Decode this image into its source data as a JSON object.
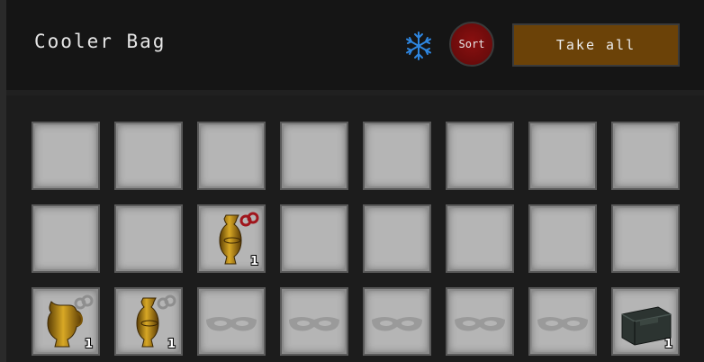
{
  "container": {
    "title": "Cooler Bag",
    "icons": {
      "freeze": "snowflake-icon",
      "freeze_color": "#2e86e0"
    },
    "buttons": {
      "sort_label": "Sort",
      "take_all_label": "Take all"
    }
  },
  "grid": {
    "rows": [
      [
        {
          "state": "empty"
        },
        {
          "state": "empty"
        },
        {
          "state": "empty"
        },
        {
          "state": "empty"
        },
        {
          "state": "empty"
        },
        {
          "state": "empty"
        },
        {
          "state": "empty"
        },
        {
          "state": "empty"
        }
      ],
      [
        {
          "state": "empty"
        },
        {
          "state": "empty"
        },
        {
          "state": "item",
          "item": "brass-vase",
          "quantity": "1"
        },
        {
          "state": "empty"
        },
        {
          "state": "empty"
        },
        {
          "state": "empty"
        },
        {
          "state": "empty"
        },
        {
          "state": "empty"
        }
      ],
      [
        {
          "state": "item",
          "item": "brass-pitcher",
          "quantity": "1"
        },
        {
          "state": "item",
          "item": "brass-vase",
          "quantity": "1"
        },
        {
          "state": "locked",
          "item": "mask"
        },
        {
          "state": "locked",
          "item": "mask"
        },
        {
          "state": "locked",
          "item": "mask"
        },
        {
          "state": "locked",
          "item": "mask"
        },
        {
          "state": "locked",
          "item": "mask"
        },
        {
          "state": "item",
          "item": "dark-crate",
          "quantity": "1"
        }
      ]
    ]
  }
}
